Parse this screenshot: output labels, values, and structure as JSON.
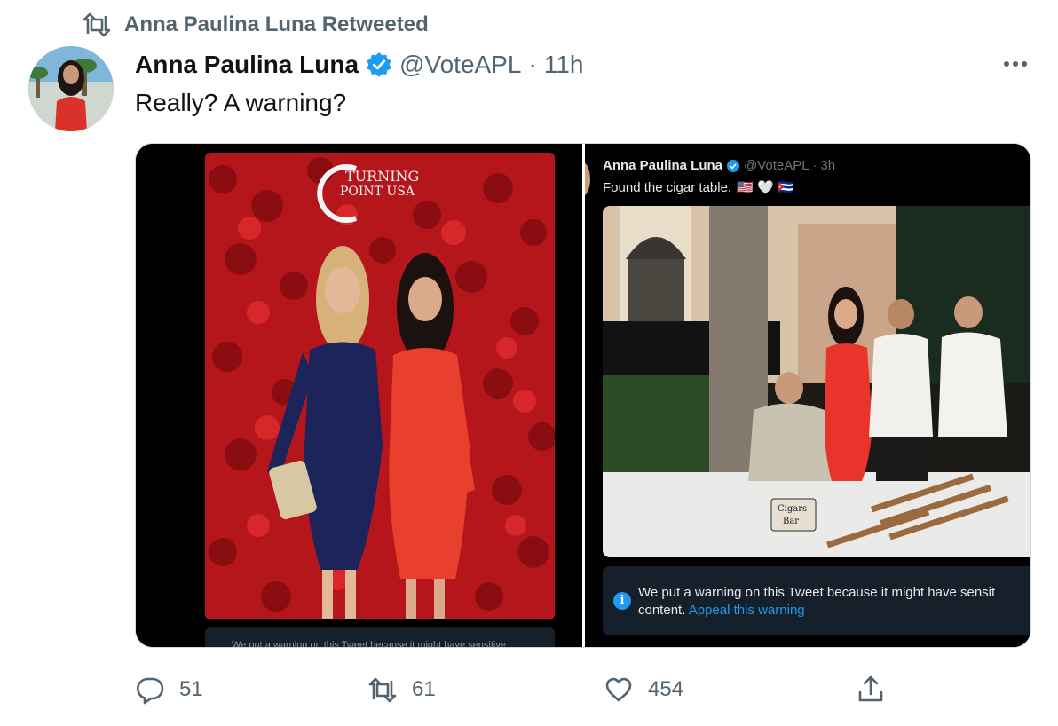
{
  "retweet": {
    "text": "Anna Paulina Luna Retweeted",
    "icon": "retweet-icon"
  },
  "tweet": {
    "author_name": "Anna Paulina Luna",
    "handle": "@VoteAPL",
    "separator": "·",
    "time": "11h",
    "text": "Really? A warning?",
    "verified": true
  },
  "media": {
    "left": {
      "backdrop_logo": "TURNING POINT USA",
      "warning_partial": "We put a warning on this Tweet because it might have sensitive"
    },
    "right": {
      "embedded_name": "Anna Paulina Luna",
      "embedded_meta": "@VoteAPL · 3h",
      "embedded_text": "Found the cigar table.",
      "emoji": "🇺🇸 🤍 🇨🇺",
      "sign_text": "Cigars Bar",
      "warning_line1": "We put a warning on this Tweet because it might have sensit",
      "warning_line2": "content.",
      "appeal_link": "Appeal this warning"
    }
  },
  "actions": {
    "reply_count": "51",
    "retweet_count": "61",
    "like_count": "454"
  },
  "colors": {
    "primary_text": "#0f1419",
    "secondary_text": "#536471",
    "accent": "#1d9bf0",
    "border": "#cfd9de"
  }
}
